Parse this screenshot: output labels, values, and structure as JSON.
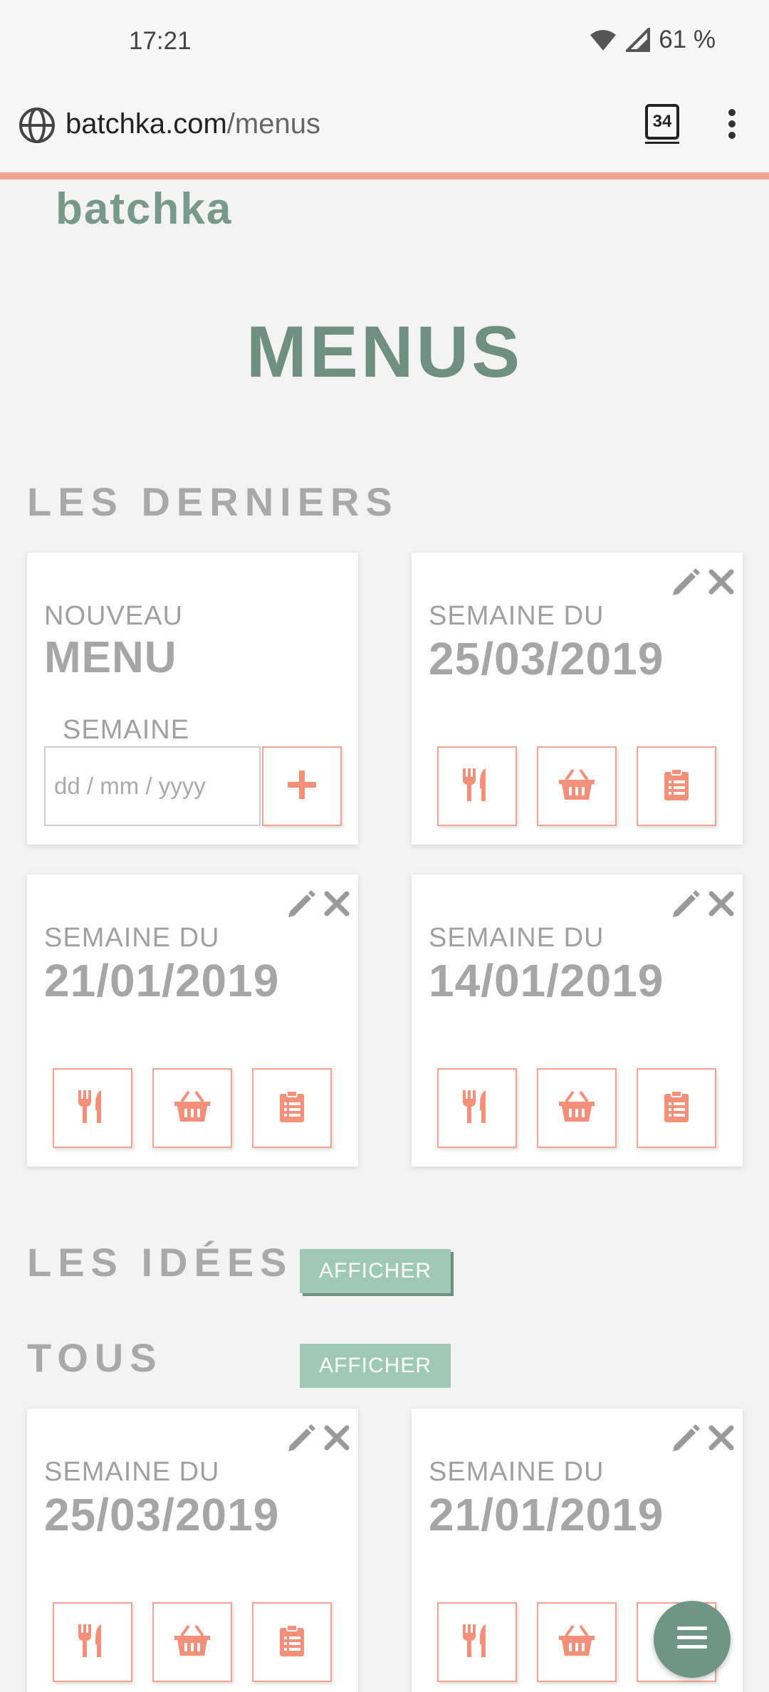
{
  "status": {
    "time": "17:21",
    "battery": "61 %"
  },
  "browser": {
    "url_host": "batchka.com",
    "url_path": "/menus",
    "tab_count": "34"
  },
  "brand": "batchka",
  "page_title": "MENUS",
  "sections": {
    "recent_title": "LES DERNIERS",
    "ideas_title": "LES IDÉES",
    "all_title": "TOUS",
    "show_label": "AFFICHER"
  },
  "new_menu": {
    "label_top": "NOUVEAU",
    "label_main": "MENU",
    "week_label": "SEMAINE",
    "date_placeholder": "dd / mm / yyyy"
  },
  "week_label": "SEMAINE DU",
  "recent_cards": [
    {
      "date": "25/03/2019"
    },
    {
      "date": "21/01/2019"
    },
    {
      "date": "14/01/2019"
    }
  ],
  "all_cards": [
    {
      "date": "25/03/2019"
    },
    {
      "date": "21/01/2019"
    }
  ],
  "colors": {
    "accent": "#f4a392",
    "brand": "#779a8c",
    "button": "#9fc9b6"
  }
}
